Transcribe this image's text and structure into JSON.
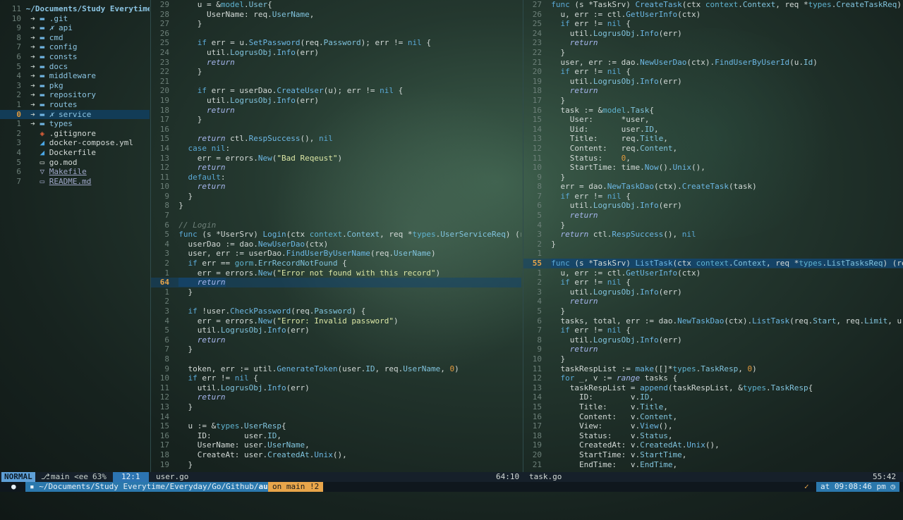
{
  "explorer": {
    "path": "~/Documents/Study Everytime/E",
    "items": [
      {
        "num": "11",
        "name": "~/Documents/Study Everytime/E",
        "type": "root"
      },
      {
        "num": "10",
        "name": ".git",
        "type": "dir"
      },
      {
        "num": "9",
        "name": "api",
        "type": "dir",
        "mod": "✗"
      },
      {
        "num": "8",
        "name": "cmd",
        "type": "dir"
      },
      {
        "num": "7",
        "name": "config",
        "type": "dir"
      },
      {
        "num": "6",
        "name": "consts",
        "type": "dir"
      },
      {
        "num": "5",
        "name": "docs",
        "type": "dir"
      },
      {
        "num": "4",
        "name": "middleware",
        "type": "dir"
      },
      {
        "num": "3",
        "name": "pkg",
        "type": "dir"
      },
      {
        "num": "2",
        "name": "repository",
        "type": "dir"
      },
      {
        "num": "1",
        "name": "routes",
        "type": "dir"
      },
      {
        "num": "0",
        "name": "service",
        "type": "dir",
        "mod": "✗",
        "selected": true
      },
      {
        "num": "1",
        "name": "types",
        "type": "dir"
      },
      {
        "num": "2",
        "name": ".gitignore",
        "type": "gitignore"
      },
      {
        "num": "3",
        "name": "docker-compose.yml",
        "type": "docker"
      },
      {
        "num": "4",
        "name": "Dockerfile",
        "type": "docker"
      },
      {
        "num": "5",
        "name": "go.mod",
        "type": "go"
      },
      {
        "num": "6",
        "name": "Makefile",
        "type": "make"
      },
      {
        "num": "7",
        "name": "README.md",
        "type": "md"
      }
    ]
  },
  "left_code": [
    [
      "29",
      "    u = &model.User{"
    ],
    [
      "28",
      "      UserName: req.UserName,"
    ],
    [
      "27",
      "    }"
    ],
    [
      "26",
      ""
    ],
    [
      "25",
      "    if err = u.SetPassword(req.Password); err != nil {"
    ],
    [
      "24",
      "      util.LogrusObj.Info(err)"
    ],
    [
      "23",
      "      return"
    ],
    [
      "22",
      "    }"
    ],
    [
      "21",
      ""
    ],
    [
      "20",
      "    if err = userDao.CreateUser(u); err != nil {"
    ],
    [
      "19",
      "      util.LogrusObj.Info(err)"
    ],
    [
      "18",
      "      return"
    ],
    [
      "17",
      "    }"
    ],
    [
      "16",
      ""
    ],
    [
      "15",
      "    return ctl.RespSuccess(), nil"
    ],
    [
      "14",
      "  case nil:"
    ],
    [
      "13",
      "    err = errors.New(\"Bad Reqeust\")"
    ],
    [
      "12",
      "    return"
    ],
    [
      "11",
      "  default:"
    ],
    [
      "10",
      "    return"
    ],
    [
      "9",
      "  }"
    ],
    [
      "8",
      "}"
    ],
    [
      "7",
      ""
    ],
    [
      "6",
      "// Login"
    ],
    [
      "5",
      "func (s *UserSrv) Login(ctx context.Context, req *types.UserServiceReq) (resp inte"
    ],
    [
      "4",
      "  userDao := dao.NewUserDao(ctx)"
    ],
    [
      "3",
      "  user, err := userDao.FindUserByUserName(req.UserName)"
    ],
    [
      "2",
      "  if err == gorm.ErrRecordNotFound {"
    ],
    [
      "1",
      "    err = errors.New(\"Error not found with this record\")"
    ],
    [
      "64",
      "    return"
    ],
    [
      "1",
      "  }"
    ],
    [
      "2",
      ""
    ],
    [
      "3",
      "  if !user.CheckPassword(req.Password) {"
    ],
    [
      "4",
      "    err = errors.New(\"Error: Invalid password\")"
    ],
    [
      "5",
      "    util.LogrusObj.Info(err)"
    ],
    [
      "6",
      "    return"
    ],
    [
      "7",
      "  }"
    ],
    [
      "8",
      ""
    ],
    [
      "9",
      "  token, err := util.GenerateToken(user.ID, req.UserName, 0)"
    ],
    [
      "10",
      "  if err != nil {"
    ],
    [
      "11",
      "    util.LogrusObj.Info(err)"
    ],
    [
      "12",
      "    return"
    ],
    [
      "13",
      "  }"
    ],
    [
      "14",
      ""
    ],
    [
      "15",
      "  u := &types.UserResp{"
    ],
    [
      "16",
      "    ID:       user.ID,"
    ],
    [
      "17",
      "    UserName: user.UserName,"
    ],
    [
      "18",
      "    CreateAt: user.CreatedAt.Unix(),"
    ],
    [
      "19",
      "  }"
    ]
  ],
  "right_code": [
    [
      "27",
      "func (s *TaskSrv) CreateTask(ctx context.Context, req *types.CreateTaskReq) (resp i"
    ],
    [
      "26",
      "  u, err := ctl.GetUserInfo(ctx)"
    ],
    [
      "25",
      "  if err != nil {"
    ],
    [
      "24",
      "    util.LogrusObj.Info(err)"
    ],
    [
      "23",
      "    return"
    ],
    [
      "22",
      "  }"
    ],
    [
      "21",
      "  user, err := dao.NewUserDao(ctx).FindUserByUserId(u.Id)"
    ],
    [
      "20",
      "  if err != nil {"
    ],
    [
      "19",
      "    util.LogrusObj.Info(err)"
    ],
    [
      "18",
      "    return"
    ],
    [
      "17",
      "  }"
    ],
    [
      "16",
      "  task := &model.Task{"
    ],
    [
      "15",
      "    User:      *user,"
    ],
    [
      "14",
      "    Uid:       user.ID,"
    ],
    [
      "13",
      "    Title:     req.Title,"
    ],
    [
      "12",
      "    Content:   req.Content,"
    ],
    [
      "11",
      "    Status:    0,"
    ],
    [
      "10",
      "    StartTime: time.Now().Unix(),"
    ],
    [
      "9",
      "  }"
    ],
    [
      "8",
      "  err = dao.NewTaskDao(ctx).CreateTask(task)"
    ],
    [
      "7",
      "  if err != nil {"
    ],
    [
      "6",
      "    util.LogrusObj.Info(err)"
    ],
    [
      "5",
      "    return"
    ],
    [
      "4",
      "  }"
    ],
    [
      "3",
      "  return ctl.RespSuccess(), nil"
    ],
    [
      "2",
      "}"
    ],
    [
      "1",
      ""
    ],
    [
      "55",
      "func (s *TaskSrv) ListTask(ctx context.Context, req *types.ListTasksReq) (resp inte"
    ],
    [
      "1",
      "  u, err := ctl.GetUserInfo(ctx)"
    ],
    [
      "2",
      "  if err != nil {"
    ],
    [
      "3",
      "    util.LogrusObj.Info(err)"
    ],
    [
      "4",
      "    return"
    ],
    [
      "5",
      "  }"
    ],
    [
      "6",
      "  tasks, total, err := dao.NewTaskDao(ctx).ListTask(req.Start, req.Limit, u.Id)"
    ],
    [
      "7",
      "  if err != nil {"
    ],
    [
      "8",
      "    util.LogrusObj.Info(err)"
    ],
    [
      "9",
      "    return"
    ],
    [
      "10",
      "  }"
    ],
    [
      "11",
      "  taskRespList := make([]*types.TaskResp, 0)"
    ],
    [
      "12",
      "  for _, v := range tasks {"
    ],
    [
      "13",
      "    taskRespList = append(taskRespList, &types.TaskResp{"
    ],
    [
      "14",
      "      ID:        v.ID,"
    ],
    [
      "15",
      "      Title:     v.Title,"
    ],
    [
      "16",
      "      Content:   v.Content,"
    ],
    [
      "17",
      "      View:      v.View(),"
    ],
    [
      "18",
      "      Status:    v.Status,"
    ],
    [
      "19",
      "      CreatedAt: v.CreatedAt.Unix(),"
    ],
    [
      "20",
      "      StartTime: v.StartTime,"
    ],
    [
      "21",
      "      EndTime:   v.EndTime,"
    ]
  ],
  "status": {
    "mode": "NORMAL",
    "branch": "main <ee",
    "percent": "63%",
    "position": "12:1",
    "left_file": "user.go",
    "left_pos": "64:10",
    "right_file": "task.go",
    "right_pos": "55:42"
  },
  "shell": {
    "path": "~/Documents/Study Everytime/Everyday/Go/Github/",
    "path_bold": "authen",
    "git": "on  main !2",
    "check": "✓",
    "time": "at 09:08:46 pm"
  },
  "colors": {
    "accent": "#5fa0d8",
    "selection": "#123c57",
    "warn": "#e8a54a"
  }
}
